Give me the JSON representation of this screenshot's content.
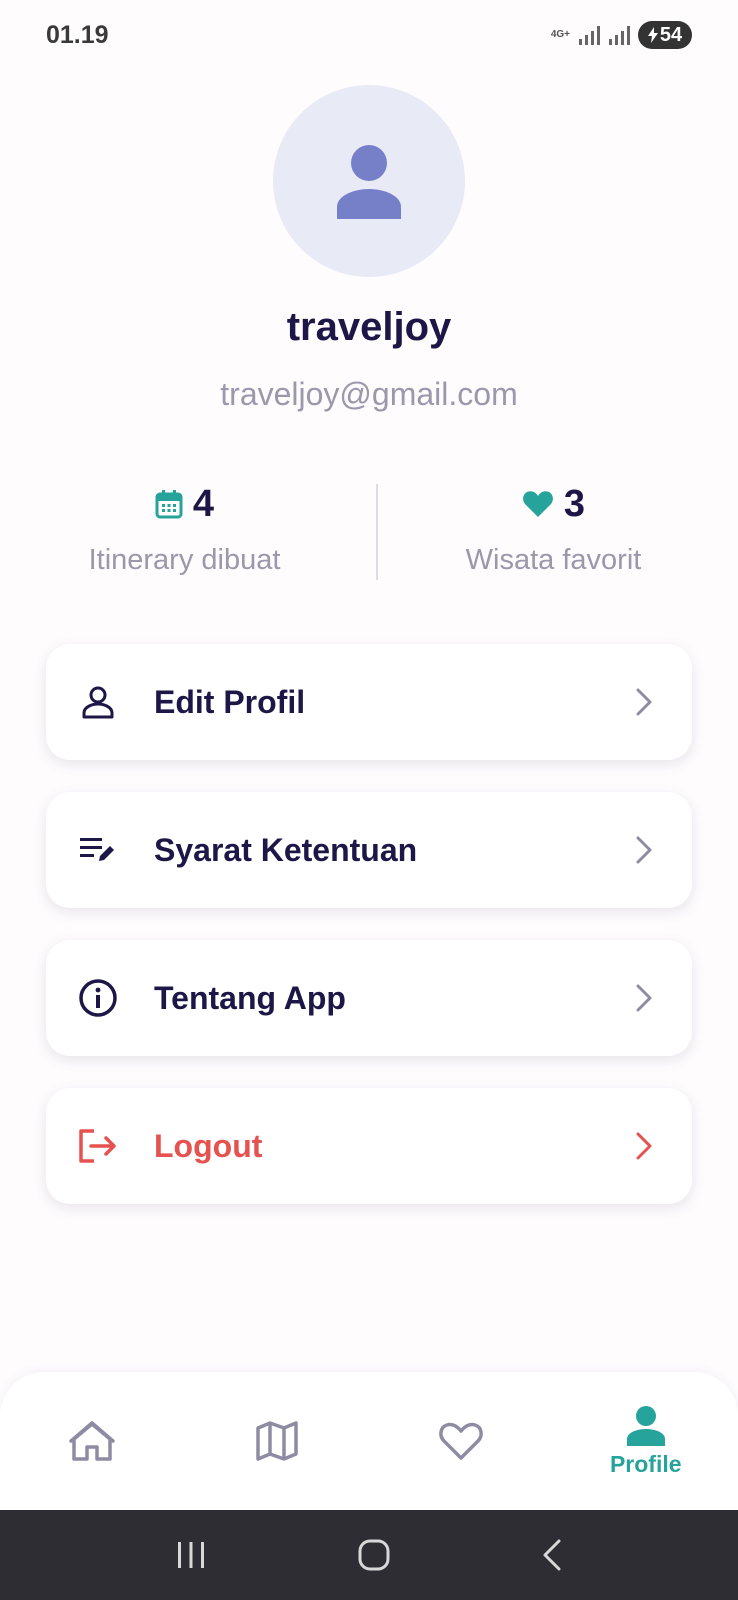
{
  "status_bar": {
    "time": "01.19",
    "network": "4G+",
    "battery": "54"
  },
  "profile": {
    "name": "traveljoy",
    "email": "traveljoy@gmail.com"
  },
  "stats": [
    {
      "value": "4",
      "label": "Itinerary dibuat",
      "icon": "calendar-icon",
      "color": "#26a39a"
    },
    {
      "value": "3",
      "label": "Wisata favorit",
      "icon": "heart-icon",
      "color": "#26a39a"
    }
  ],
  "menu": {
    "edit_profile": "Edit Profil",
    "terms": "Syarat Ketentuan",
    "about": "Tentang App",
    "logout": "Logout"
  },
  "bottom_nav": {
    "items": [
      {
        "icon": "home-icon",
        "active": false
      },
      {
        "icon": "map-icon",
        "active": false
      },
      {
        "icon": "heart-outline-icon",
        "active": false
      },
      {
        "icon": "person-icon",
        "label": "Profile",
        "active": true
      }
    ]
  },
  "colors": {
    "primary_text": "#1d1747",
    "accent_teal": "#26a39a",
    "logout_red": "#e5524f",
    "avatar_bg": "#e8eaf6",
    "avatar_icon": "#7580c9"
  }
}
